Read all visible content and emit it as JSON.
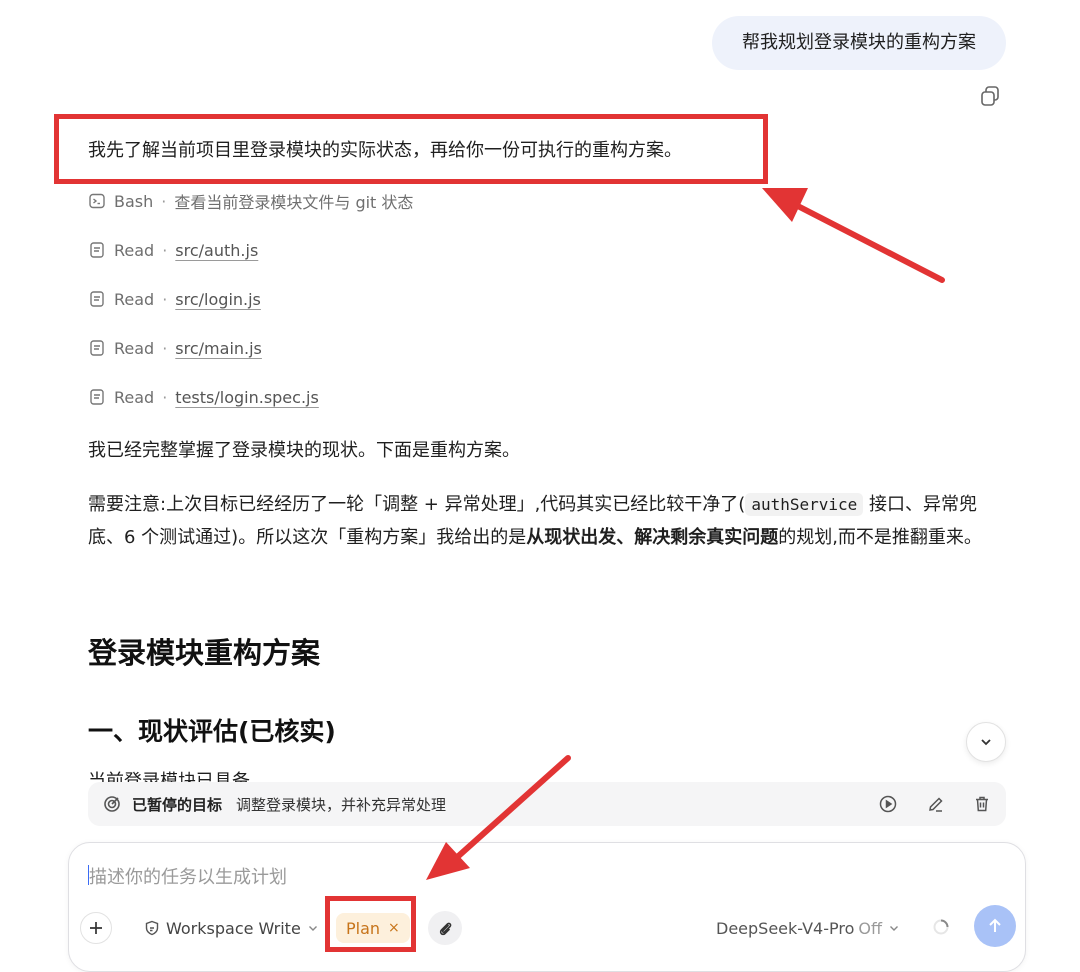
{
  "user_message": "帮我规划登录模块的重构方案",
  "assistant": {
    "intro": "我先了解当前项目里登录模块的实际状态，再给你一份可执行的重构方案。",
    "tool_calls": [
      {
        "tool": "Bash",
        "target": "查看当前登录模块文件与 git 状态",
        "icon": "terminal-icon",
        "is_link": false
      },
      {
        "tool": "Read",
        "target": "src/auth.js",
        "icon": "file-icon",
        "is_link": true
      },
      {
        "tool": "Read",
        "target": "src/login.js",
        "icon": "file-icon",
        "is_link": true
      },
      {
        "tool": "Read",
        "target": "src/main.js",
        "icon": "file-icon",
        "is_link": true
      },
      {
        "tool": "Read",
        "target": "tests/login.spec.js",
        "icon": "file-icon",
        "is_link": true
      }
    ],
    "summary": "我已经完整掌握了登录模块的现状。下面是重构方案。",
    "note": {
      "part1": "需要注意:上次目标已经经历了一轮「调整 + 异常处理」,代码其实已经比较干净了(",
      "code": "authService",
      "part2": " 接口、异常兜底、6 个测试通过)。所以这次「重构方案」我给出的是",
      "bold": "从现状出发、解决剩余真实问题",
      "part3": "的规划,而不是推翻重来。"
    },
    "heading1": "登录模块重构方案",
    "heading2": "一、现状评估(已核实)",
    "cut_line": "当前登录模块已具备"
  },
  "goal_bar": {
    "title": "已暂停的目标",
    "description": "调整登录模块，并补充异常处理",
    "icon": "goal-icon",
    "actions": [
      "play-icon",
      "edit-icon",
      "trash-icon"
    ]
  },
  "composer": {
    "placeholder": "描述你的任务以生成计划",
    "permission": "Workspace Write",
    "mode_chip": "Plan",
    "mode_chip_close": "×",
    "model": "DeepSeek-V4-Pro",
    "thinking": "Off"
  },
  "colors": {
    "annotation": "#e23434",
    "accent": "#3b6cf5",
    "send_button": "#a9c2f7",
    "plan_chip_bg": "#fdf0dc",
    "plan_chip_text": "#c7741a"
  }
}
